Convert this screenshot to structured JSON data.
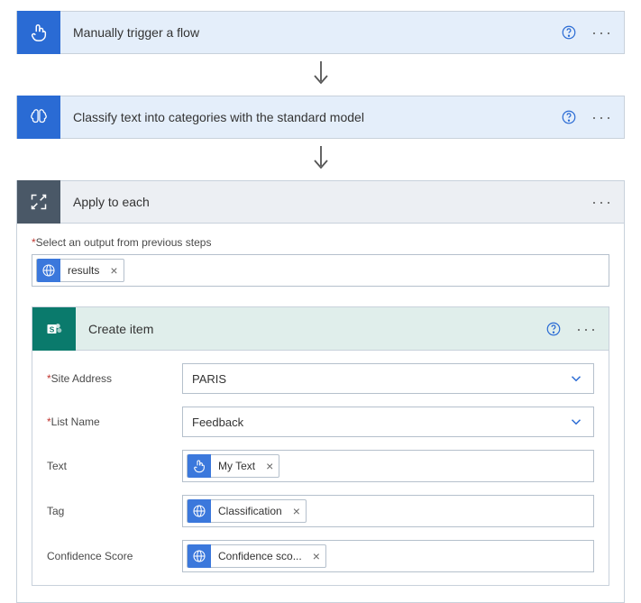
{
  "step1": {
    "title": "Manually trigger a flow"
  },
  "step2": {
    "title": "Classify text into categories with the standard model"
  },
  "apply": {
    "title": "Apply to each",
    "outputLabel": "Select an output from previous steps",
    "token": "results"
  },
  "create": {
    "title": "Create item",
    "fields": {
      "siteAddress": {
        "label": "Site Address",
        "value": "PARIS"
      },
      "listName": {
        "label": "List Name",
        "value": "Feedback"
      },
      "text": {
        "label": "Text",
        "token": "My Text"
      },
      "tag": {
        "label": "Tag",
        "token": "Classification"
      },
      "confidence": {
        "label": "Confidence Score",
        "token": "Confidence sco..."
      }
    }
  }
}
